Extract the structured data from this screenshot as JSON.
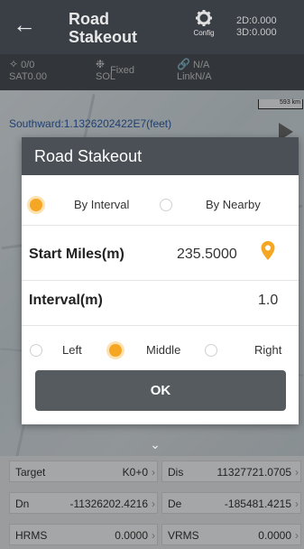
{
  "topbar": {
    "back_icon": "arrow-left-icon",
    "title_line1": "Road",
    "title_line2": "Stakeout",
    "config_label": "Config",
    "precision_2d": "2D:0.000",
    "precision_3d": "3D:0.000"
  },
  "status": {
    "sat_count": "0/0",
    "sat_value": "0.00",
    "sat_label": "SAT",
    "sol_label": "SOL",
    "sol_value": "Fixed",
    "link_label": "Link",
    "link_value": "N/A",
    "link_top": "N/A"
  },
  "map": {
    "scale_label": "593 km",
    "coord_text": "Southward:1.1326202422E7(feet)"
  },
  "dialog": {
    "title": "Road Stakeout",
    "mode_options": [
      {
        "label": "By Interval",
        "selected": true
      },
      {
        "label": "By Nearby",
        "selected": false
      }
    ],
    "start_miles_label": "Start Miles(m)",
    "start_miles_value": "235.5000",
    "interval_label": "Interval(m)",
    "interval_value": "1.0",
    "side_options": [
      {
        "label": "Left",
        "selected": false
      },
      {
        "label": "Middle",
        "selected": true
      },
      {
        "label": "Right",
        "selected": false
      }
    ],
    "ok_label": "OK"
  },
  "panel": {
    "target_label": "Target",
    "target_value": "K0+0",
    "dis_label": "Dis",
    "dis_value": "11327721.0705",
    "dn_label": "Dn",
    "dn_value": "-11326202.4216",
    "de_label": "De",
    "de_value": "-185481.4215",
    "hrms_label": "HRMS",
    "hrms_value": "0.0000",
    "vrms_label": "VRMS",
    "vrms_value": "0.0000"
  },
  "colors": {
    "accent": "#f5a623",
    "header": "#3a3f45",
    "button": "#565b60"
  }
}
